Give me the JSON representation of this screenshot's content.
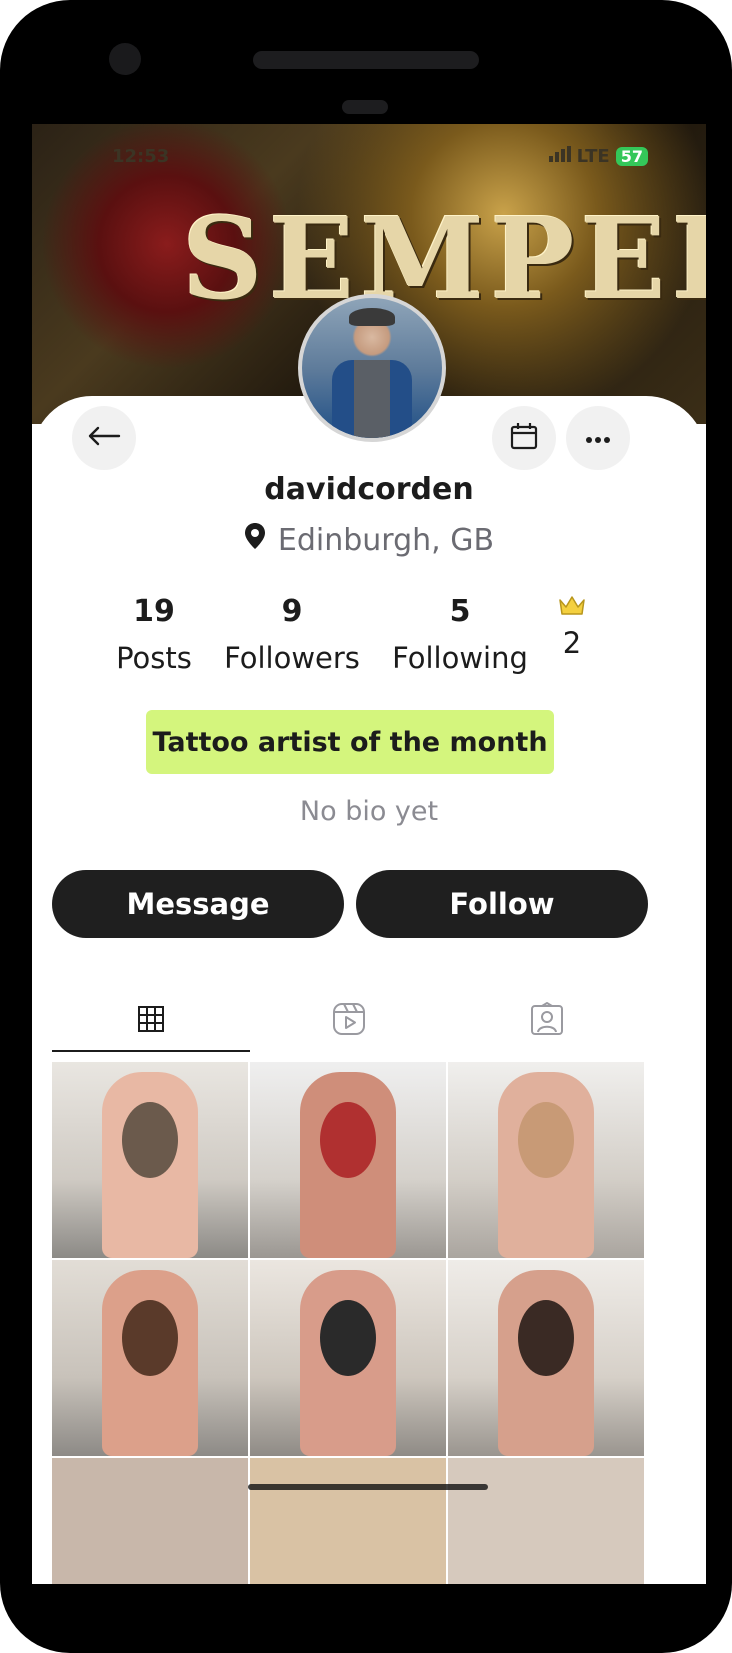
{
  "status_bar": {
    "time": "12:53",
    "network": "LTE",
    "battery": "57"
  },
  "cover": {
    "title": "SEMPER"
  },
  "profile": {
    "username": "davidcorden",
    "location": "Edinburgh, GB",
    "stats": {
      "posts_count": "19",
      "posts_label": "Posts",
      "followers_count": "9",
      "followers_label": "Followers",
      "following_count": "5",
      "following_label": "Following",
      "crown_count": "2"
    },
    "award": "Tattoo artist of the month",
    "bio": "No bio yet"
  },
  "actions": {
    "message_label": "Message",
    "follow_label": "Follow"
  },
  "tabs": [
    {
      "name": "grid",
      "icon": "grid-icon",
      "active": true
    },
    {
      "name": "reels",
      "icon": "reels-icon",
      "active": false
    },
    {
      "name": "tagged",
      "icon": "tagged-icon",
      "active": false
    }
  ],
  "colors": {
    "award_bg": "#d4f57d",
    "button_bg": "#1f1f1f",
    "crown": "#f4d03f"
  }
}
